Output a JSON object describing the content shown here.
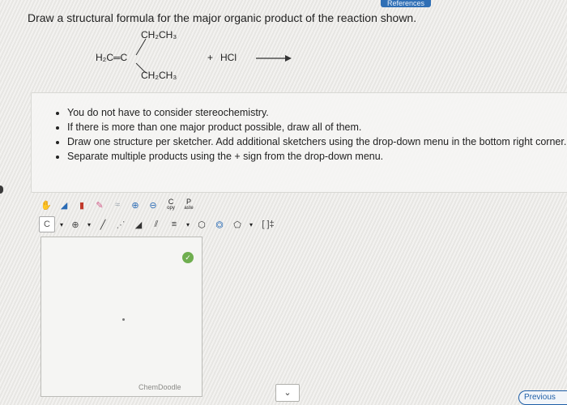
{
  "header": {
    "references_tab": "References"
  },
  "question": {
    "text": "Draw a structural formula for the major organic product of the reaction shown."
  },
  "reaction": {
    "top_substituent": "CH₂CH₃",
    "left_group": "H₂C═C",
    "bottom_substituent": "CH₂CH₃",
    "plus": "+",
    "reagent": "HCl"
  },
  "instructions": [
    "You do not have to consider stereochemistry.",
    "If there is more than one major product possible, draw all of them.",
    "Draw one structure per sketcher. Add additional sketchers using the drop-down menu in the bottom right corner.",
    "Separate multiple products using the + sign from the drop-down menu."
  ],
  "sketcher": {
    "toolbar_row1": [
      {
        "name": "hand-icon",
        "glyph": "✋",
        "color": "#e07b1a"
      },
      {
        "name": "lasso-icon",
        "glyph": "◢",
        "color": "#2a6bb5"
      },
      {
        "name": "eraser-icon",
        "glyph": "▮",
        "color": "#c0392b"
      },
      {
        "name": "pencil-icon",
        "glyph": "✎",
        "color": "#d35b8a"
      },
      {
        "name": "chain-icon",
        "glyph": "≈",
        "color": "#9aa3ad"
      },
      {
        "name": "zoom-in-icon",
        "glyph": "⊕",
        "color": "#2a6bb5"
      },
      {
        "name": "zoom-out-icon",
        "glyph": "⊖",
        "color": "#2a6bb5"
      }
    ],
    "copy_label": "C",
    "copy_sub": "opy",
    "paste_label": "P",
    "paste_sub": "aste",
    "atom_label": "C",
    "charge_label": "⊕",
    "ring_brackets": "[ ]‡",
    "branding": "ChemDoodle"
  },
  "dropdown": {
    "glyph": "⌄"
  },
  "navigation": {
    "previous_label": "Previous"
  },
  "colors": {
    "accent": "#2f6fb5",
    "canvas_bg": "#f5f5f3",
    "ok_green": "#6fae4f"
  }
}
